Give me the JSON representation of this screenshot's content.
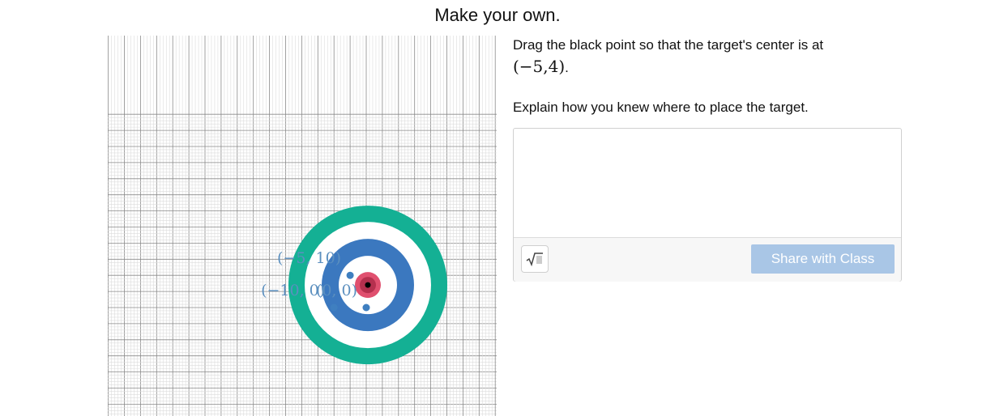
{
  "page": {
    "title": "Make your own."
  },
  "graph": {
    "points": [
      {
        "label": "(−5, 10)",
        "x": -5,
        "y": 10
      },
      {
        "label": "(−10, 0)",
        "x": -10,
        "y": 0
      },
      {
        "label": "(0, 0)",
        "x": 0,
        "y": 0
      }
    ],
    "target": {
      "x": 0.5,
      "y": 7
    },
    "colors": {
      "point": "#3f7fc0",
      "label": "#5b8fbf",
      "outer_ring": "#14b094",
      "middle_ring": "#3b78bf",
      "bullseye": "#e0506f",
      "handle": "#000000",
      "grid_major": "#8a8a8a",
      "grid_minor": "#dcdcdc"
    }
  },
  "panel": {
    "prompt": "Drag the black point so that the target's center is at",
    "target_coord": "(−5,4)",
    "question": "Explain how you knew where to place the target.",
    "answer_value": "",
    "math_button_icon": "sqrt-icon",
    "share_label": "Share with Class",
    "share_color": "#a9c6e6"
  }
}
